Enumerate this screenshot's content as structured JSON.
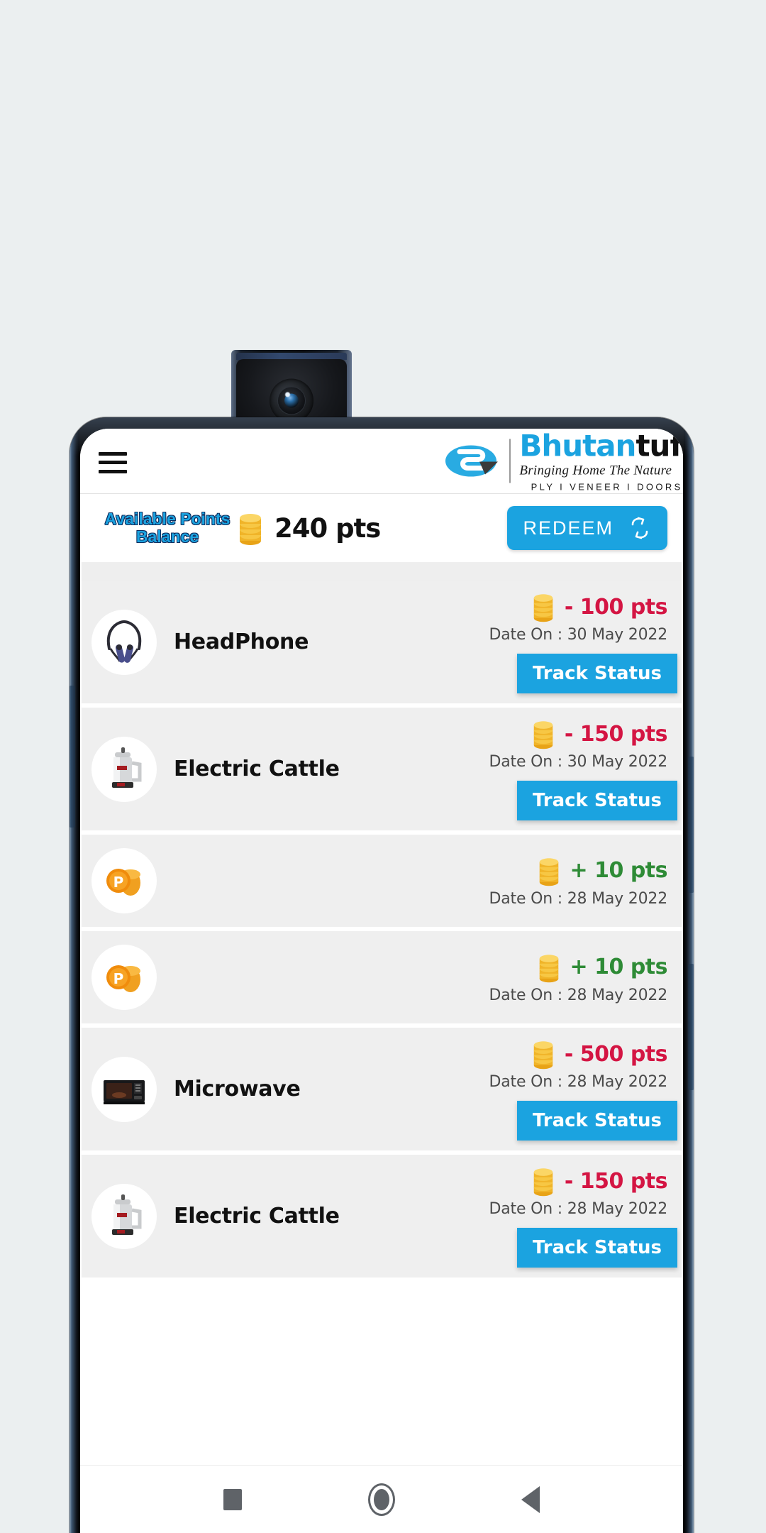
{
  "device": {
    "camera": "popup-front-camera",
    "nav_bar": {
      "recents": "recents-square",
      "home": "home-circle",
      "back": "back-triangle"
    }
  },
  "header": {
    "menu_icon": "hamburger-menu-icon",
    "logo": {
      "mark": "bhutan-tuff-logo-mark",
      "title_primary": "Bhutan",
      "title_secondary": "tuff",
      "tagline": "Bringing Home The Nature",
      "subtitle": "PLY I VENEER I DOORS"
    }
  },
  "balance": {
    "label": "Available Points Balance",
    "coin_icon": "coin-stack-icon",
    "amount": "240 pts",
    "redeem_label": "REDEEM",
    "redeem_icon": "sync-arrows-icon"
  },
  "colors": {
    "accent_blue": "#1ba3e0",
    "debit_red": "#d41543",
    "credit_green": "#2e8b36",
    "row_bg": "#efefef",
    "page_bg": "#ebeff0"
  },
  "transactions": [
    {
      "name": "HeadPhone",
      "thumb": "headphone-neckband-icon",
      "points": "- 100 pts",
      "type": "debit",
      "date": "Date On : 30 May 2022",
      "track_label": "Track Status",
      "has_track": true
    },
    {
      "name": "Electric Cattle",
      "thumb": "electric-kettle-icon",
      "points": "- 150 pts",
      "type": "debit",
      "date": "Date On : 30 May 2022",
      "track_label": "Track Status",
      "has_track": true
    },
    {
      "name": "",
      "thumb": "points-coin-icon",
      "points": "+ 10 pts",
      "type": "credit",
      "date": "Date On : 28 May 2022",
      "track_label": "",
      "has_track": false
    },
    {
      "name": "",
      "thumb": "points-coin-icon",
      "points": "+ 10 pts",
      "type": "credit",
      "date": "Date On : 28 May 2022",
      "track_label": "",
      "has_track": false
    },
    {
      "name": "Microwave",
      "thumb": "microwave-oven-icon",
      "points": "- 500 pts",
      "type": "debit",
      "date": "Date On : 28 May 2022",
      "track_label": "Track Status",
      "has_track": true
    },
    {
      "name": "Electric Cattle",
      "thumb": "electric-kettle-icon",
      "points": "- 150 pts",
      "type": "debit",
      "date": "Date On : 28 May 2022",
      "track_label": "Track Status",
      "has_track": true
    }
  ]
}
